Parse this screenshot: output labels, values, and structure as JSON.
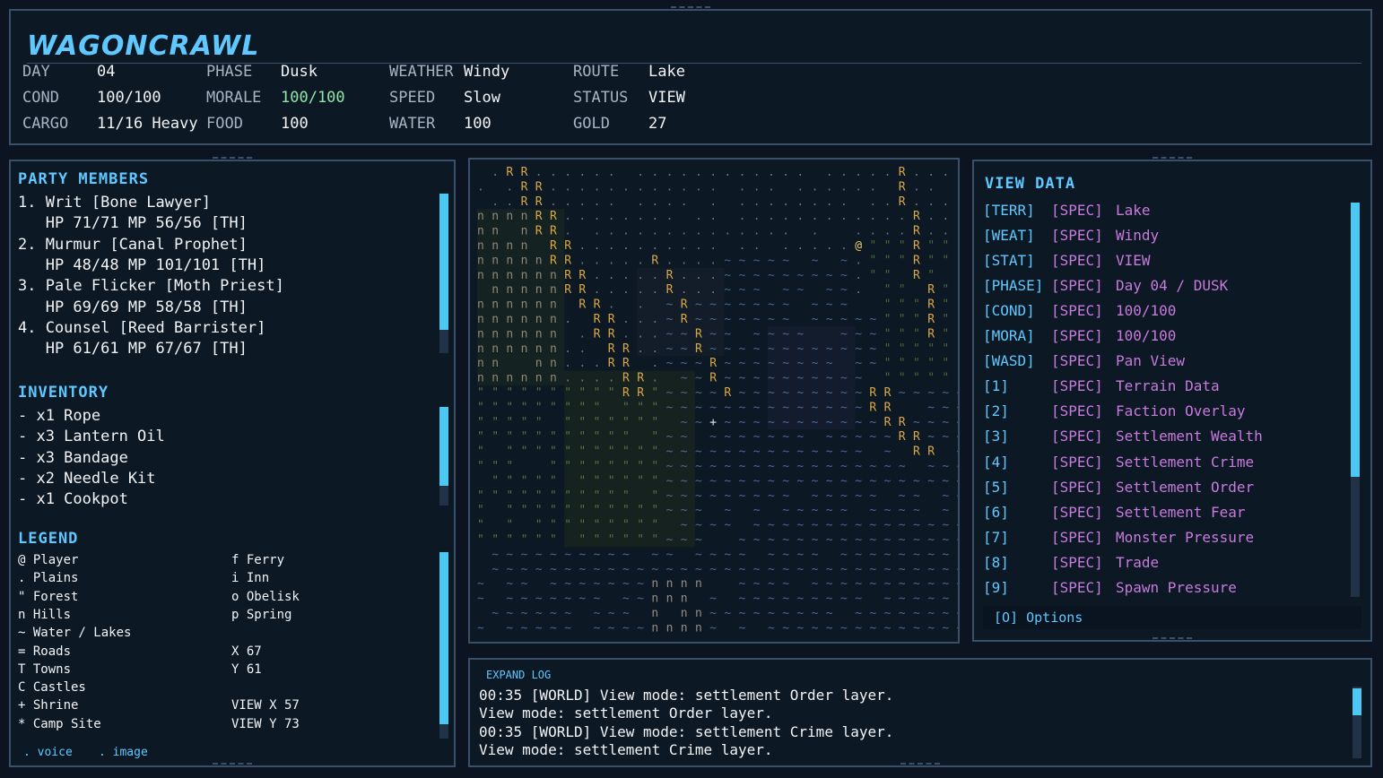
{
  "header": {
    "title": "WAGONCRAWL",
    "stats": [
      {
        "label": "DAY",
        "value": "04"
      },
      {
        "label": "PHASE",
        "value": "Dusk"
      },
      {
        "label": "WEATHER",
        "value": "Windy"
      },
      {
        "label": "ROUTE",
        "value": "Lake"
      },
      {
        "label": "COND",
        "value": "100/100"
      },
      {
        "label": "MORALE",
        "value": "100/100"
      },
      {
        "label": "SPEED",
        "value": "Slow"
      },
      {
        "label": "STATUS",
        "value": "VIEW"
      },
      {
        "label": "CARGO",
        "value": "11/16 Heavy"
      },
      {
        "label": "FOOD",
        "value": "100"
      },
      {
        "label": "WATER",
        "value": "100"
      },
      {
        "label": "GOLD",
        "value": "27"
      }
    ]
  },
  "party": {
    "title": "PARTY MEMBERS",
    "lines": [
      "1. Writ [Bone Lawyer]",
      "   HP 71/71 MP 56/56 [TH]",
      "2. Murmur [Canal Prophet]",
      "   HP 48/48 MP 101/101 [TH]",
      "3. Pale Flicker [Moth Priest]",
      "   HP 69/69 MP 58/58 [TH]",
      "4. Counsel [Reed Barrister]",
      "   HP 61/61 MP 67/67 [TH]"
    ]
  },
  "inventory": {
    "title": "INVENTORY",
    "items": [
      "- x1 Rope",
      "- x3 Lantern Oil",
      "- x3 Bandage",
      "- x2 Needle Kit",
      "- x1 Cookpot"
    ]
  },
  "legend": {
    "title": "LEGEND",
    "left": [
      "@ Player",
      ". Plains",
      "\" Forest",
      "n Hills",
      "~ Water / Lakes",
      "= Roads",
      "T Towns",
      "C Castles",
      "+ Shrine",
      "* Camp Site"
    ],
    "right": [
      "f Ferry",
      "i Inn",
      "o Obelisk",
      "p Spring",
      "",
      "X 67",
      "Y 61",
      "",
      "VIEW X 57",
      "VIEW Y 73"
    ]
  },
  "footer_links": {
    "voice": ". voice",
    "image": ". image"
  },
  "view_data": {
    "title": "VIEW DATA",
    "rows": [
      {
        "key": "[TERR]",
        "spec": "[SPEC]",
        "value": "Lake"
      },
      {
        "key": "[WEAT]",
        "spec": "[SPEC]",
        "value": "Windy"
      },
      {
        "key": "[STAT]",
        "spec": "[SPEC]",
        "value": "VIEW"
      },
      {
        "key": "[PHASE]",
        "spec": "[SPEC]",
        "value": "Day 04 / DUSK"
      },
      {
        "key": "[COND]",
        "spec": "[SPEC]",
        "value": "100/100"
      },
      {
        "key": "[MORA]",
        "spec": "[SPEC]",
        "value": "100/100"
      },
      {
        "key": "[WASD]",
        "spec": "[SPEC]",
        "value": "Pan View"
      },
      {
        "key": "[1]",
        "spec": "[SPEC]",
        "value": "Terrain Data"
      },
      {
        "key": "[2]",
        "spec": "[SPEC]",
        "value": "Faction Overlay"
      },
      {
        "key": "[3]",
        "spec": "[SPEC]",
        "value": "Settlement Wealth"
      },
      {
        "key": "[4]",
        "spec": "[SPEC]",
        "value": "Settlement Crime"
      },
      {
        "key": "[5]",
        "spec": "[SPEC]",
        "value": "Settlement Order"
      },
      {
        "key": "[6]",
        "spec": "[SPEC]",
        "value": "Settlement Fear"
      },
      {
        "key": "[7]",
        "spec": "[SPEC]",
        "value": "Monster Pressure"
      },
      {
        "key": "[8]",
        "spec": "[SPEC]",
        "value": "Trade"
      },
      {
        "key": "[9]",
        "spec": "[SPEC]",
        "value": "Spawn Pressure"
      }
    ],
    "options_label": "[O] Options"
  },
  "log": {
    "expand_label": "EXPAND LOG",
    "lines": [
      "00:35 [WORLD] View mode: settlement Order layer.",
      "View mode: settlement Order layer.",
      "00:35 [WORLD] View mode: settlement Crime layer.",
      "View mode: settlement Crime layer."
    ]
  },
  "colors": {
    "accent": "#5ec8ff",
    "spec": "#c77bdc",
    "green": "#8ee6a8",
    "river": "#d9a845",
    "water": "#5a86b8",
    "forest": "#5f8a4a",
    "hills": "#b7aa98"
  }
}
